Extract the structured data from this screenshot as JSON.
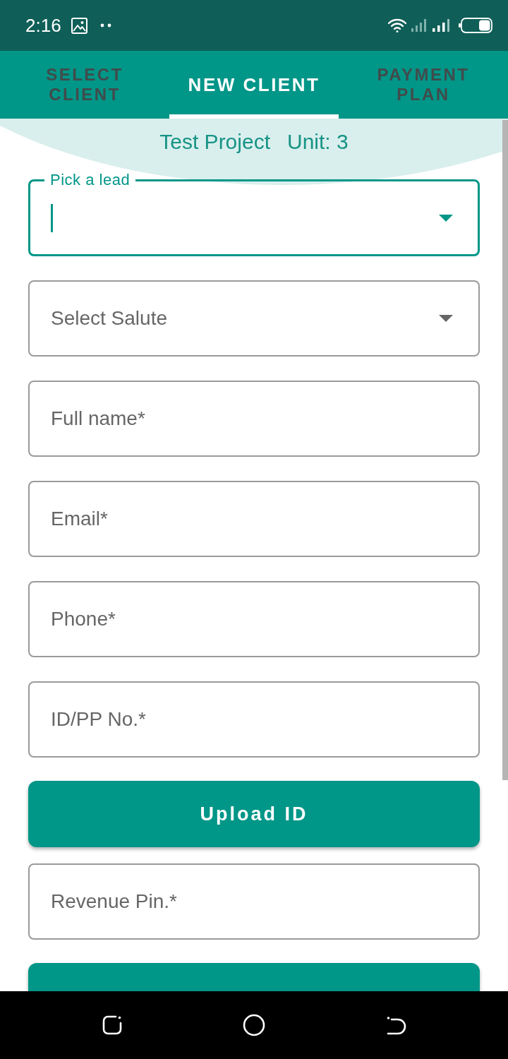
{
  "status_bar": {
    "time": "2:16"
  },
  "tabs": [
    {
      "label": "SELECT CLIENT",
      "selected": false
    },
    {
      "label": "NEW CLIENT",
      "selected": true
    },
    {
      "label": "PAYMENT PLAN",
      "selected": false
    }
  ],
  "header": {
    "project": "Test Project",
    "unit": "Unit: 3"
  },
  "form": [
    {
      "kind": "select",
      "label": "Pick a lead",
      "focused": true
    },
    {
      "kind": "select",
      "placeholder": "Select Salute",
      "focused": false
    },
    {
      "kind": "input",
      "placeholder": "Full name*",
      "focused": false
    },
    {
      "kind": "input",
      "placeholder": "Email*",
      "focused": false
    },
    {
      "kind": "input",
      "placeholder": "Phone*",
      "focused": false
    },
    {
      "kind": "input",
      "placeholder": "ID/PP No.*",
      "focused": false
    },
    {
      "kind": "button",
      "label": "Upload ID"
    },
    {
      "kind": "input",
      "placeholder": "Revenue Pin.*",
      "focused": false
    },
    {
      "kind": "button"
    }
  ]
}
